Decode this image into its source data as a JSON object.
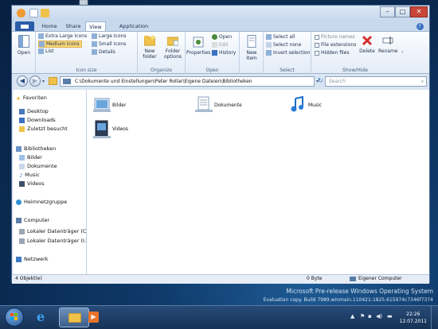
{
  "titlebar": {
    "minimize": "–",
    "maximize": "□",
    "close": "✕"
  },
  "ribbon_tabs": [
    "Home",
    "Share",
    "View",
    "Application"
  ],
  "ribbon": {
    "navigation_pane": {
      "open_label": "Open"
    },
    "layout": {
      "items": [
        "Extra Large Icons",
        "Medium Icons",
        "List",
        "Large Icons",
        "Small Icons",
        "Details"
      ],
      "group_label": "Icon size"
    },
    "organize": {
      "new_folder": [
        "New",
        "folder"
      ],
      "folder_options": [
        "Folder",
        "options"
      ],
      "group_label": "Organize"
    },
    "open": {
      "properties": "Properties",
      "open": "Open",
      "edit": "Edit",
      "history": "History",
      "group_label": "Open"
    },
    "new": {
      "new_item": [
        "New",
        "item"
      ]
    },
    "select": {
      "select_all": "Select all",
      "select_none": "Select none",
      "invert_selection": "Invert selection",
      "group_label": "Select"
    },
    "showhide": {
      "picture_names": "Picture names",
      "file_extensions": "File extensions",
      "hidden_files": "Hidden files",
      "delete": "Delete",
      "rename": "Rename",
      "group_label": "Show/Hide"
    }
  },
  "address": {
    "path": "C:\\Dokumente und Einstellungen\\Peter Rollar\\Eigene Dateien\\Bibliotheken",
    "search_placeholder": "Search"
  },
  "nav": {
    "favorites": "Favoriten",
    "desktop": "Desktop",
    "downloads": "Downloads",
    "recent": "Zuletzt besucht",
    "libraries": "Bibliotheken",
    "pictures": "Bilder",
    "documents": "Dokumente",
    "music": "Music",
    "videos": "Videos",
    "homegroup": "Heimnetzgruppe",
    "computer": "Computer",
    "drive_c": "Lokaler Datenträger (C:)",
    "drive_i": "Lokaler Datenträger (I:)",
    "network": "Netzwerk"
  },
  "content": {
    "items": [
      "Bilder",
      "Dokumente",
      "Music",
      "Videos"
    ]
  },
  "status": {
    "count": "4 Objekt(e)",
    "size": "0 Byte",
    "location": "Eigener Computer"
  },
  "watermark": {
    "line1": "Microsoft Pre-release Windows Operating System",
    "line2": "Evaluation copy. Build 7989.winmain.110421-1825.615974c7346f7374"
  },
  "clock": {
    "time": "22:26",
    "date": "12.07.2011"
  },
  "colors": {
    "file_tab": "#2b5ca8",
    "close_button": "#c8453a",
    "accent_folder": "#f0c24a"
  }
}
